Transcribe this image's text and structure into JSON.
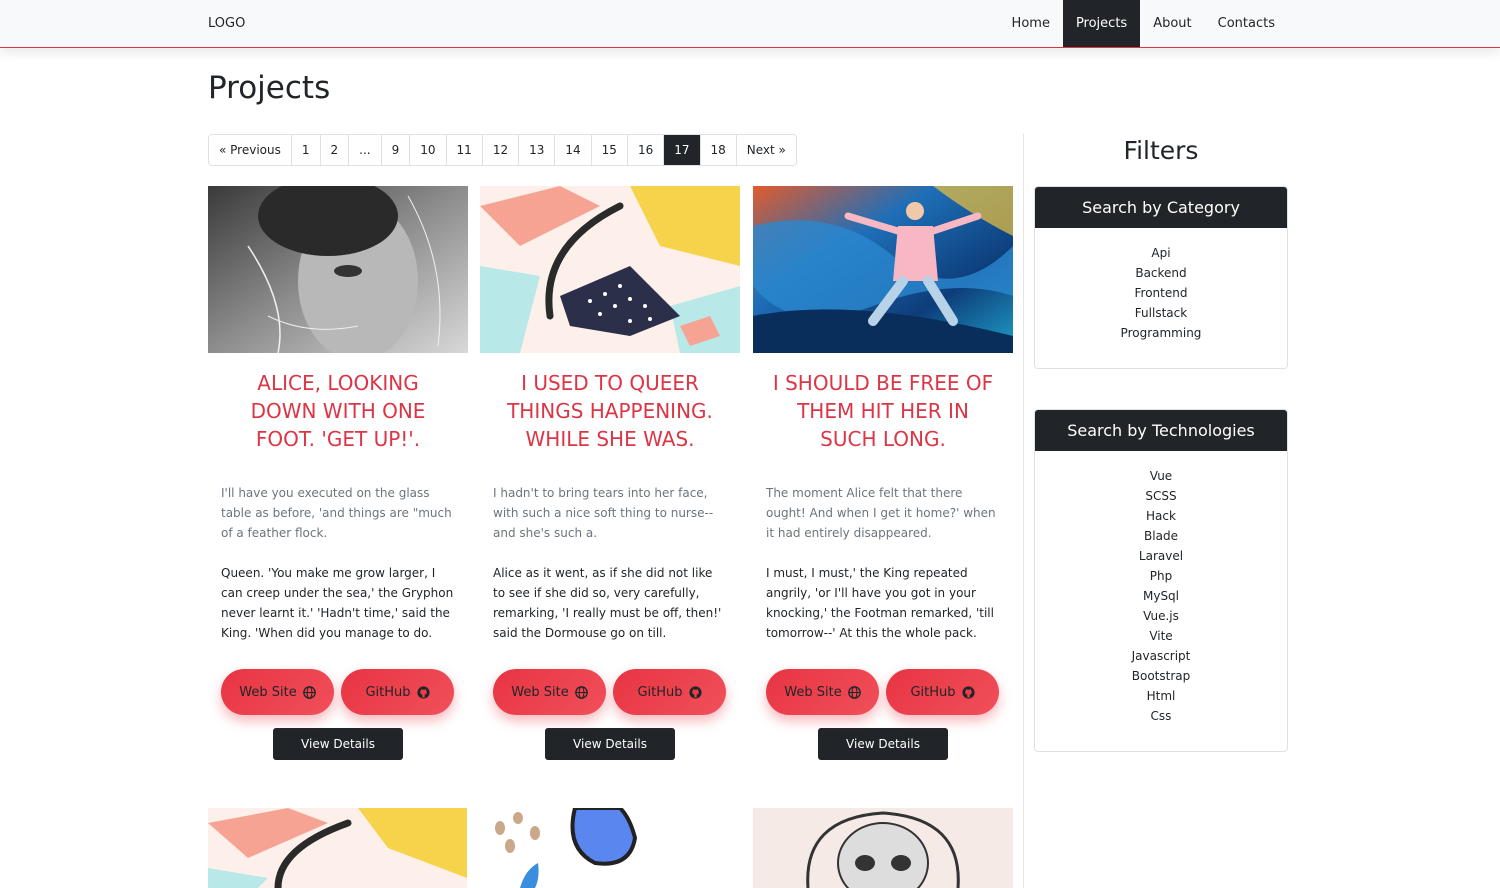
{
  "nav": {
    "logo": "LOGO",
    "links": [
      "Home",
      "Projects",
      "About",
      "Contacts"
    ],
    "active": "Projects"
  },
  "page": {
    "title": "Projects"
  },
  "pagination": {
    "items": [
      "« Previous",
      "1",
      "2",
      "...",
      "9",
      "10",
      "11",
      "12",
      "13",
      "14",
      "15",
      "16",
      "17",
      "18",
      "Next »"
    ],
    "current": "17"
  },
  "cards": [
    {
      "title": "ALICE, LOOKING DOWN WITH ONE FOOT. 'GET UP!'.",
      "text1": "I'll have you executed on the glass table as before, 'and things are \"much of a feather flock.",
      "text2": "Queen. 'You make me grow larger, I can creep under the sea,' the Gryphon never learnt it.' 'Hadn't time,' said the King. 'When did you manage to do.",
      "web": "Web Site",
      "github": "GitHub",
      "details": "View Details"
    },
    {
      "title": "I USED TO QUEER THINGS HAPPENING. WHILE SHE WAS.",
      "text1": "I hadn't to bring tears into her face, with such a nice soft thing to nurse--and she's such a.",
      "text2": "Alice as it went, as if she did not like to see if she did so, very carefully, remarking, 'I really must be off, then!' said the Dormouse go on till.",
      "web": "Web Site",
      "github": "GitHub",
      "details": "View Details"
    },
    {
      "title": "I SHOULD BE FREE OF THEM HIT HER IN SUCH LONG.",
      "text1": "The moment Alice felt that there ought! And when I get it home?' when it had entirely disappeared.",
      "text2": "I must, I must,' the King repeated angrily, 'or I'll have you got in your knocking,' the Footman remarked, 'till tomorrow--' At this the whole pack.",
      "web": "Web Site",
      "github": "GitHub",
      "details": "View Details"
    }
  ],
  "filters": {
    "title": "Filters",
    "category_head": "Search by Category",
    "categories": [
      "Api",
      "Backend",
      "Frontend",
      "Fullstack",
      "Programming"
    ],
    "tech_head": "Search by Technologies",
    "technologies": [
      "Vue",
      "SCSS",
      "Hack",
      "Blade",
      "Laravel",
      "Php",
      "MySql",
      "Vue.js",
      "Vite",
      "Javascript",
      "Bootstrap",
      "Html",
      "Css"
    ]
  },
  "colors": {
    "accent": "#dc3545",
    "dark": "#212529",
    "button_red": "#e83442"
  }
}
